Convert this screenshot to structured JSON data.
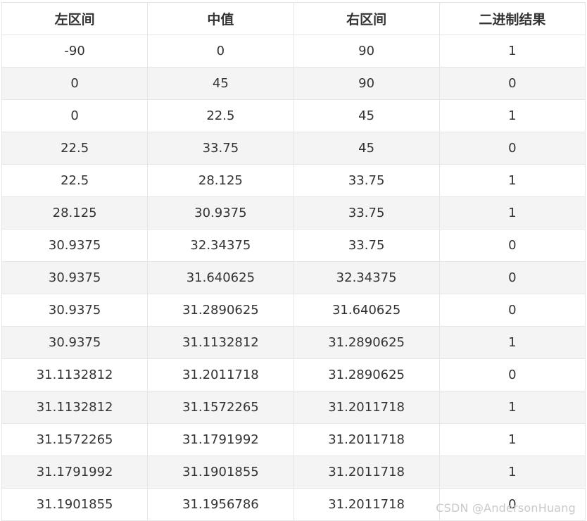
{
  "table": {
    "headers": [
      "左区间",
      "中值",
      "右区间",
      "二进制结果"
    ],
    "rows": [
      [
        "-90",
        "0",
        "90",
        "1"
      ],
      [
        "0",
        "45",
        "90",
        "0"
      ],
      [
        "0",
        "22.5",
        "45",
        "1"
      ],
      [
        "22.5",
        "33.75",
        "45",
        "0"
      ],
      [
        "22.5",
        "28.125",
        "33.75",
        "1"
      ],
      [
        "28.125",
        "30.9375",
        "33.75",
        "1"
      ],
      [
        "30.9375",
        "32.34375",
        "33.75",
        "0"
      ],
      [
        "30.9375",
        "31.640625",
        "32.34375",
        "0"
      ],
      [
        "30.9375",
        "31.2890625",
        "31.640625",
        "0"
      ],
      [
        "30.9375",
        "31.1132812",
        "31.2890625",
        "1"
      ],
      [
        "31.1132812",
        "31.2011718",
        "31.2890625",
        "0"
      ],
      [
        "31.1132812",
        "31.1572265",
        "31.2011718",
        "1"
      ],
      [
        "31.1572265",
        "31.1791992",
        "31.2011718",
        "1"
      ],
      [
        "31.1791992",
        "31.1901855",
        "31.2011718",
        "1"
      ],
      [
        "31.1901855",
        "31.1956786",
        "31.2011718",
        "0"
      ]
    ]
  },
  "watermark": "CSDN @AndersonHuang"
}
